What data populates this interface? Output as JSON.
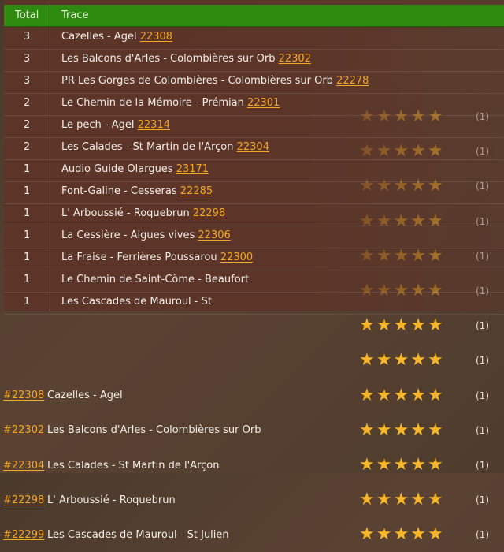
{
  "trace_table": {
    "headers": {
      "total": "Total",
      "trace": "Trace"
    },
    "rows": [
      {
        "total": "3",
        "name": "Cazelles - Agel",
        "id": "22308"
      },
      {
        "total": "3",
        "name": "Les Balcons d'Arles - Colombières sur Orb",
        "id": "22302"
      },
      {
        "total": "3",
        "name": "PR Les Gorges de Colombières - Colombières sur Orb",
        "id": "22278"
      },
      {
        "total": "2",
        "name": "Le Chemin de la Mémoire - Prémian",
        "id": "22301"
      },
      {
        "total": "2",
        "name": "Le pech - Agel",
        "id": "22314"
      },
      {
        "total": "2",
        "name": "Les Calades - St Martin de l'Arçon",
        "id": "22304"
      },
      {
        "total": "1",
        "name": "Audio Guide Olargues",
        "id": "23171"
      },
      {
        "total": "1",
        "name": "Font-Galine - Cesseras",
        "id": "22285"
      },
      {
        "total": "1",
        "name": "L' Arboussié - Roquebrun",
        "id": "22298"
      },
      {
        "total": "1",
        "name": "La Cessière - Aigues vives",
        "id": "22306"
      },
      {
        "total": "1",
        "name": "La Fraise - Ferrières Poussarou",
        "id": "22300"
      },
      {
        "total": "1",
        "name": "Le Chemin de Saint-Côme - Beaufort",
        "id": ""
      },
      {
        "total": "1",
        "name": "Les Cascades de Mauroul - St",
        "id": ""
      }
    ]
  },
  "rating_list": {
    "star_color": "#f5b62a",
    "items": [
      {
        "id": "",
        "title": "",
        "stars": 5,
        "count": "(1)"
      },
      {
        "id": "",
        "title": "",
        "stars": 5,
        "count": "(1)"
      },
      {
        "id": "",
        "title": "",
        "stars": 5,
        "count": "(1)"
      },
      {
        "id": "",
        "title": "",
        "stars": 5,
        "count": "(1)"
      },
      {
        "id": "",
        "title": "",
        "stars": 5,
        "count": "(1)"
      },
      {
        "id": "",
        "title": "",
        "stars": 5,
        "count": "(1)"
      },
      {
        "id": "",
        "title": "",
        "stars": 5,
        "count": "(1)"
      },
      {
        "id": "",
        "title": "",
        "stars": 5,
        "count": "(1)"
      },
      {
        "id": "#22308",
        "title": "Cazelles - Agel",
        "stars": 5,
        "count": "(1)"
      },
      {
        "id": "#22302",
        "title": "Les Balcons d'Arles - Colombières sur Orb",
        "stars": 5,
        "count": "(1)"
      },
      {
        "id": "#22304",
        "title": "Les Calades - St Martin de l'Arçon",
        "stars": 5,
        "count": "(1)"
      },
      {
        "id": "#22298",
        "title": "L' Arboussié - Roquebrun",
        "stars": 5,
        "count": "(1)"
      },
      {
        "id": "#22299",
        "title": "Les Cascades de Mauroul - St Julien",
        "stars": 5,
        "count": "(1)"
      }
    ]
  }
}
